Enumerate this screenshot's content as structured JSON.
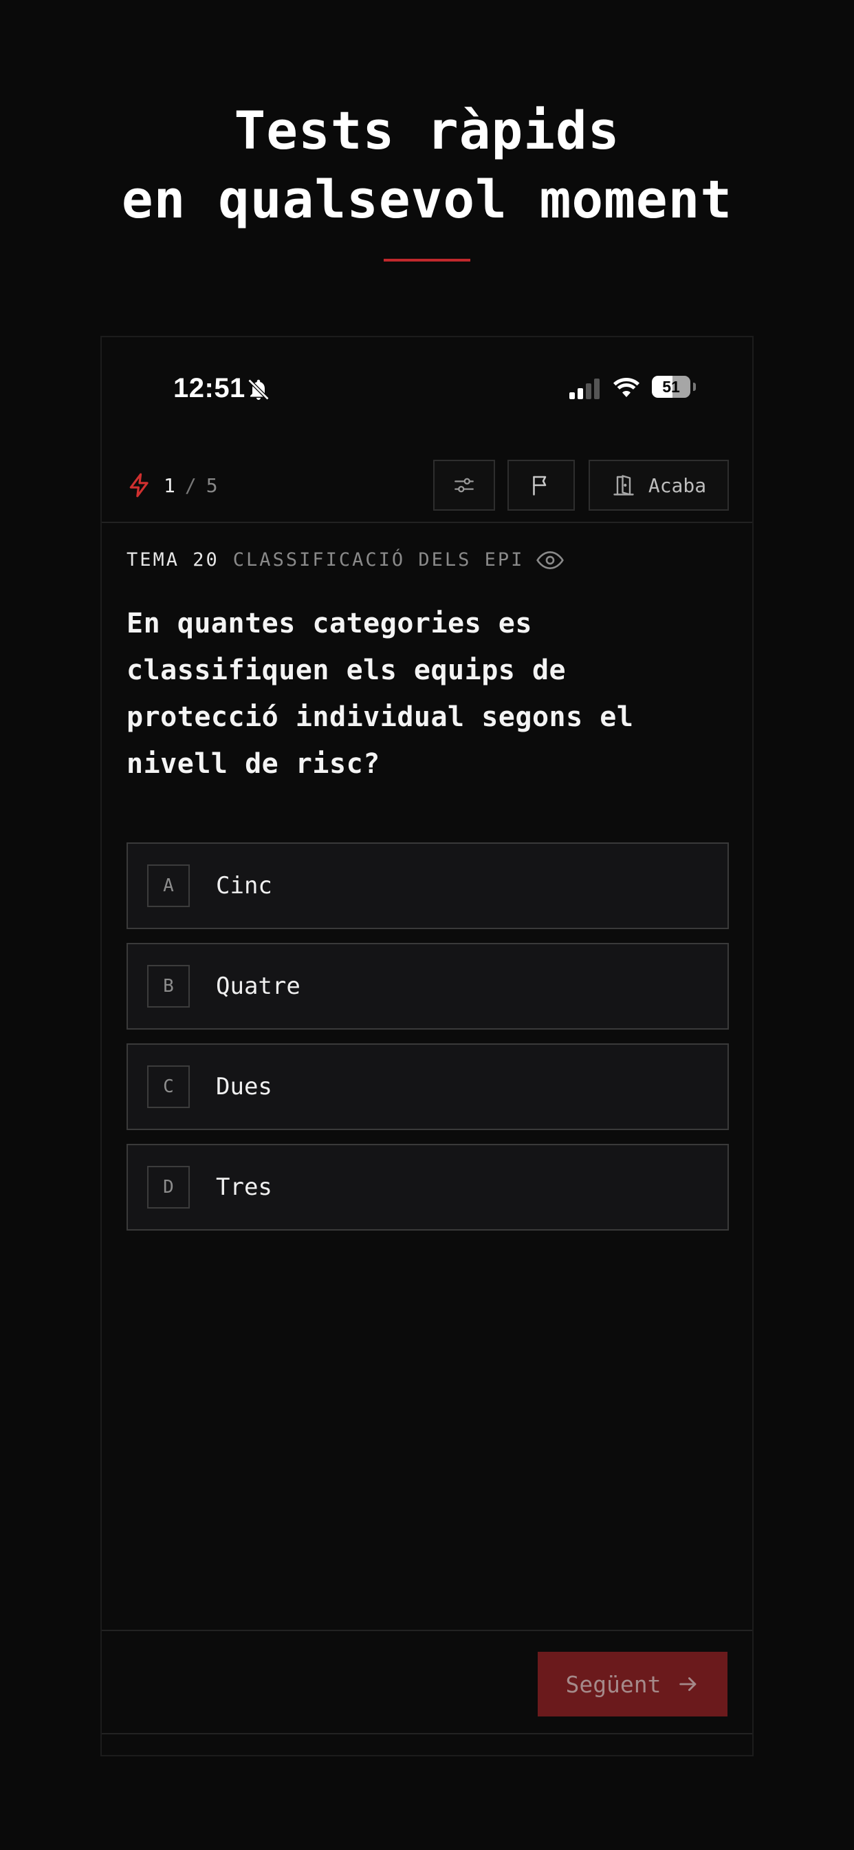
{
  "hero": {
    "line1": "Tests ràpids",
    "line2": "en qualsevol moment"
  },
  "status_bar": {
    "time": "12:51",
    "battery": "51"
  },
  "quiz": {
    "progress_current": "1",
    "progress_separator": "/",
    "progress_total": "5",
    "finish_label": "Acaba",
    "topic_number": "TEMA 20",
    "topic_name": "CLASSIFICACIÓ DELS EPI",
    "question": "En quantes categories es classifiquen els equips de protecció individual segons el nivell de risc?",
    "options": [
      {
        "letter": "A",
        "text": "Cinc"
      },
      {
        "letter": "B",
        "text": "Quatre"
      },
      {
        "letter": "C",
        "text": "Dues"
      },
      {
        "letter": "D",
        "text": "Tres"
      }
    ],
    "next_label": "Següent"
  },
  "icons": {
    "progress": "bolt-icon",
    "settings": "sliders-icon",
    "flag": "flag-icon",
    "finish": "door-exit-icon",
    "topic": "eye-icon",
    "next": "arrow-right-icon",
    "notifications": "bell-off-icon",
    "signal": "cellular-signal-icon",
    "wifi": "wifi-icon"
  },
  "colors": {
    "accent": "#c0282c",
    "next_button_bg": "#6b1a1c",
    "background": "#0a0a0a"
  }
}
